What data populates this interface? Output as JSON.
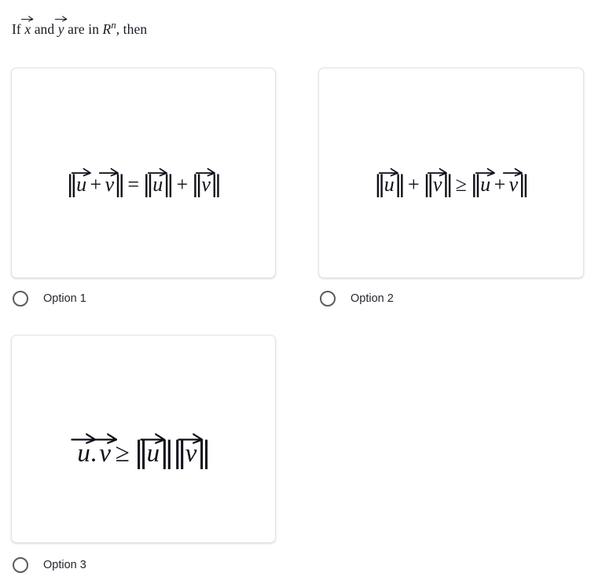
{
  "question": {
    "prefix": "If ",
    "var_1": "x",
    "conjunction": " and ",
    "var_2": "y",
    "middle": " are in ",
    "space_symbol": "R",
    "space_exponent": "n",
    "suffix": ", then",
    "plain_text": "If x⃗ and y⃗ are in R^n, then"
  },
  "options": [
    {
      "id": "option-1",
      "label": "Option 1",
      "selected": false,
      "formula_text": "||u⃗ + v⃗|| = ||u⃗|| + ||v⃗||",
      "formula_parts": {
        "bar_open": "‖",
        "u": "u",
        "plus": "+",
        "v": "v",
        "bar_close": "‖",
        "relation": "="
      }
    },
    {
      "id": "option-2",
      "label": "Option 2",
      "selected": false,
      "formula_text": "||u⃗|| + ||v⃗|| ≥ ||u⃗ + v⃗||",
      "formula_parts": {
        "bar_open": "‖",
        "u": "u",
        "plus": "+",
        "v": "v",
        "bar_close": "‖",
        "relation": "≥"
      }
    },
    {
      "id": "option-3",
      "label": "Option 3",
      "selected": false,
      "formula_text": "u⃗. v⃗ ≥ ||u⃗||||v⃗||",
      "formula_parts": {
        "bar_open": "‖",
        "u": "u",
        "dot": ".",
        "v": "v",
        "bar_close": "‖",
        "relation": "≥"
      }
    }
  ],
  "colors": {
    "page_background": "#ffffff",
    "card_background": "#ffffff",
    "card_border": "#e3e3e3",
    "formula_text": "#10101a",
    "stem_text": "#1a1a24",
    "label_text": "#26262e",
    "radio_border": "#5c5c5c"
  }
}
